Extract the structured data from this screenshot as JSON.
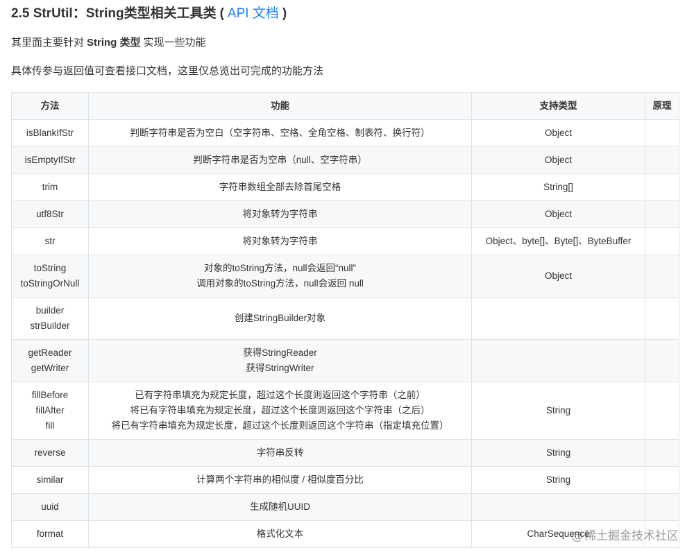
{
  "heading": {
    "title": "2.5 StrUtil：String类型相关工具类",
    "open_paren": "(",
    "link": "API 文档",
    "close_paren": ")"
  },
  "intro": {
    "line1_prefix": "其里面主要针对",
    "line1_bold": "String 类型",
    "line1_suffix": "实现一些功能",
    "line2": "具体传参与返回值可查看接口文档，这里仅总览出可完成的功能方法"
  },
  "table": {
    "headers": [
      "方法",
      "功能",
      "支持类型",
      "原理"
    ],
    "rows": [
      {
        "method": [
          "isBlankIfStr"
        ],
        "function": [
          "判断字符串是否为空白（空字符串、空格、全角空格、制表符、换行符）"
        ],
        "types": "Object",
        "principle": ""
      },
      {
        "method": [
          "isEmptyIfStr"
        ],
        "function": [
          "判断字符串是否为空串（null、空字符串）"
        ],
        "types": "Object",
        "principle": ""
      },
      {
        "method": [
          "trim"
        ],
        "function": [
          "字符串数组全部去除首尾空格"
        ],
        "types": "String[]",
        "principle": ""
      },
      {
        "method": [
          "utf8Str"
        ],
        "function": [
          "将对象转为字符串"
        ],
        "types": "Object",
        "principle": ""
      },
      {
        "method": [
          "str"
        ],
        "function": [
          "将对象转为字符串"
        ],
        "types": "Object、byte[]、Byte[]、ByteBuffer",
        "principle": ""
      },
      {
        "method": [
          "toString",
          "toStringOrNull"
        ],
        "function": [
          "对象的toString方法，null会返回“null”",
          "调用对象的toString方法，null会返回 null"
        ],
        "types": "Object",
        "principle": ""
      },
      {
        "method": [
          "builder",
          "strBuilder"
        ],
        "function": [
          "创建StringBuilder对象"
        ],
        "types": "",
        "principle": ""
      },
      {
        "method": [
          "getReader",
          "getWriter"
        ],
        "function": [
          "获得StringReader",
          "获得StringWriter"
        ],
        "types": "",
        "principle": ""
      },
      {
        "method": [
          "fillBefore",
          "fillAfter",
          "fill"
        ],
        "function": [
          "已有字符串填充为规定长度，超过这个长度则返回这个字符串（之前）",
          "将已有字符串填充为规定长度，超过这个长度则返回这个字符串（之后）",
          "将已有字符串填充为规定长度，超过这个长度则返回这个字符串（指定填充位置）"
        ],
        "types": "String",
        "principle": ""
      },
      {
        "method": [
          "reverse"
        ],
        "function": [
          "字符串反转"
        ],
        "types": "String",
        "principle": ""
      },
      {
        "method": [
          "similar"
        ],
        "function": [
          "计算两个字符串的相似度 / 相似度百分比"
        ],
        "types": "String",
        "principle": ""
      },
      {
        "method": [
          "uuid"
        ],
        "function": [
          "生成随机UUID"
        ],
        "types": "",
        "principle": ""
      },
      {
        "method": [
          "format"
        ],
        "function": [
          "格式化文本"
        ],
        "types": "CharSequence",
        "principle": ""
      }
    ]
  },
  "watermark": {
    "at": "@",
    "text": "稀土掘金技术社区"
  },
  "colors": {
    "link": "#1e80ff",
    "table_border": "#dfe2e5",
    "header_bg": "#f6f8fa",
    "stripe_bg": "#f6f8fa",
    "text": "#333333"
  }
}
